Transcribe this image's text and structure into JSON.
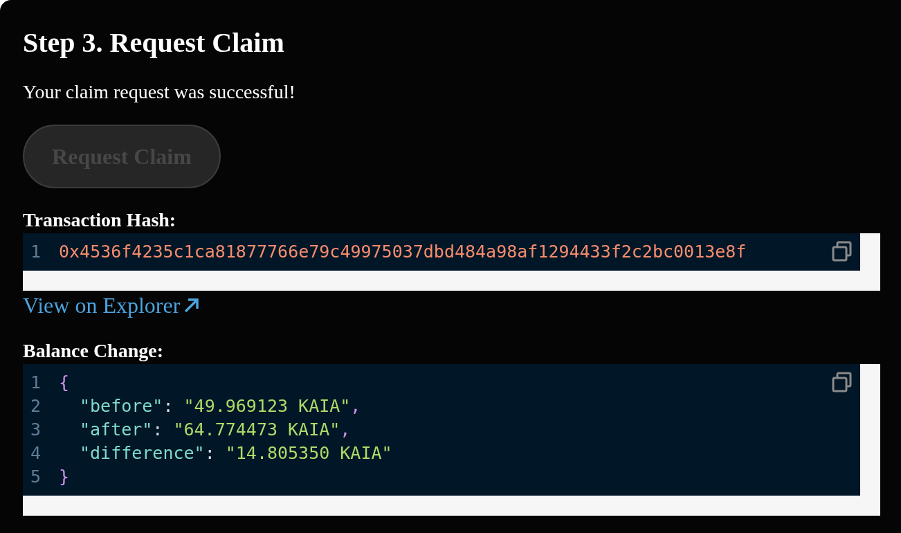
{
  "title": "Step 3. Request Claim",
  "message": "Your claim request was successful!",
  "button": {
    "label": "Request Claim",
    "disabled": true
  },
  "transaction": {
    "label": "Transaction Hash:",
    "lines": [
      {
        "number": "1",
        "indented": false,
        "tokens": [
          {
            "kind": "hash",
            "text": "0x4536f4235c1ca81877766e79c49975037dbd484a98af1294433f2c2bc0013e8f"
          }
        ]
      }
    ]
  },
  "explorer_link": {
    "label": "View on Explorer"
  },
  "balance": {
    "label": "Balance Change:",
    "lines": [
      {
        "number": "1",
        "indented": false,
        "tokens": [
          {
            "kind": "brace",
            "text": "{"
          }
        ]
      },
      {
        "number": "2",
        "indented": true,
        "tokens": [
          {
            "kind": "key",
            "text": "\"before\""
          },
          {
            "kind": "punct",
            "text": ": "
          },
          {
            "kind": "string",
            "text": "\"49.969123 KAIA\""
          },
          {
            "kind": "comma",
            "text": ","
          }
        ]
      },
      {
        "number": "3",
        "indented": true,
        "tokens": [
          {
            "kind": "key",
            "text": "\"after\""
          },
          {
            "kind": "punct",
            "text": ": "
          },
          {
            "kind": "string",
            "text": "\"64.774473 KAIA\""
          },
          {
            "kind": "comma",
            "text": ","
          }
        ]
      },
      {
        "number": "4",
        "indented": true,
        "tokens": [
          {
            "kind": "key",
            "text": "\"difference\""
          },
          {
            "kind": "punct",
            "text": ": "
          },
          {
            "kind": "string",
            "text": "\"14.805350 KAIA\""
          }
        ]
      },
      {
        "number": "5",
        "indented": false,
        "tokens": [
          {
            "kind": "brace",
            "text": "}"
          }
        ]
      }
    ]
  }
}
